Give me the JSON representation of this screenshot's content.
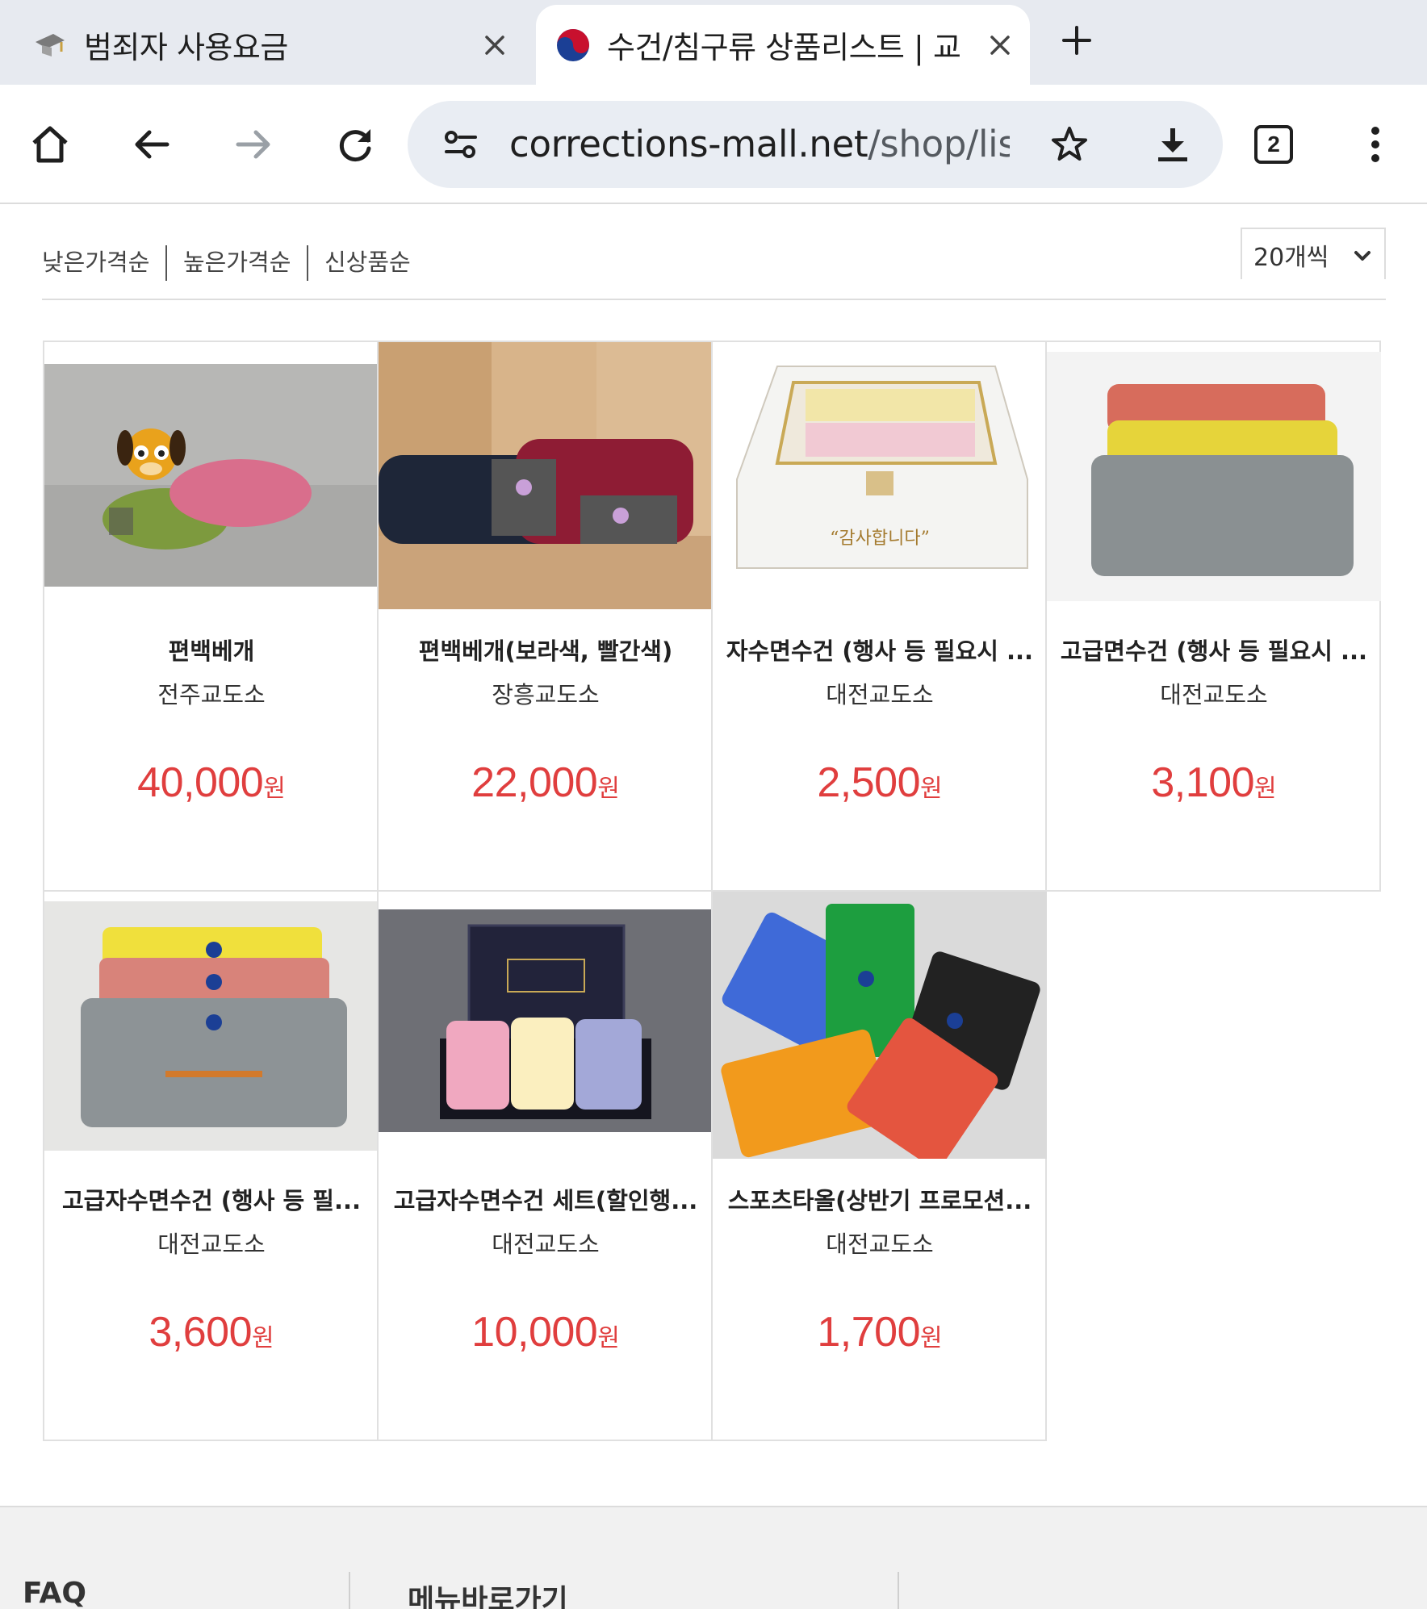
{
  "browser": {
    "tabs": [
      {
        "title": "범죄자 사용요금",
        "icon": "graduation-cap-icon",
        "active": false
      },
      {
        "title": "수건/침구류 상품리스트 | 교",
        "icon": "korea-emblem-icon",
        "active": true
      }
    ],
    "url_host": "corrections-mall.net",
    "url_path": "/shop/lis",
    "tab_count": "2"
  },
  "sort": {
    "options": [
      "낮은가격순",
      "높은가격순",
      "신상품순"
    ],
    "per_page": "20개씩"
  },
  "products": [
    {
      "name": "편백베개",
      "seller": "전주교도소",
      "price": "40,000",
      "unit": "원",
      "image": "pillow-with-dog-toy"
    },
    {
      "name": "편백베개(보라색, 빨간색)",
      "seller": "장흥교도소",
      "price": "22,000",
      "unit": "원",
      "image": "embroidered-pillows"
    },
    {
      "name": "자수면수건 (행사 등 필요시 ...",
      "seller": "대전교도소",
      "price": "2,500",
      "unit": "원",
      "image": "towel-gift-box"
    },
    {
      "name": "고급면수건 (행사 등 필요시 ...",
      "seller": "대전교도소",
      "price": "3,100",
      "unit": "원",
      "image": "stacked-towels"
    },
    {
      "name": "고급자수면수건 (행사 등 필...",
      "seller": "대전교도소",
      "price": "3,600",
      "unit": "원",
      "image": "embroidered-towels"
    },
    {
      "name": "고급자수면수건 세트(할인행...",
      "seller": "대전교도소",
      "price": "10,000",
      "unit": "원",
      "image": "premium-towel-set"
    },
    {
      "name": "스포츠타올(상반기 프로모션...",
      "seller": "대전교도소",
      "price": "1,700",
      "unit": "원",
      "image": "sports-towels"
    }
  ],
  "footer": {
    "faq": "FAQ",
    "shortcuts": "메뉴바로가기"
  },
  "colors": {
    "price": "#e03e3e",
    "tabstrip": "#e7eaf0",
    "omnibox": "#e9edf3"
  }
}
